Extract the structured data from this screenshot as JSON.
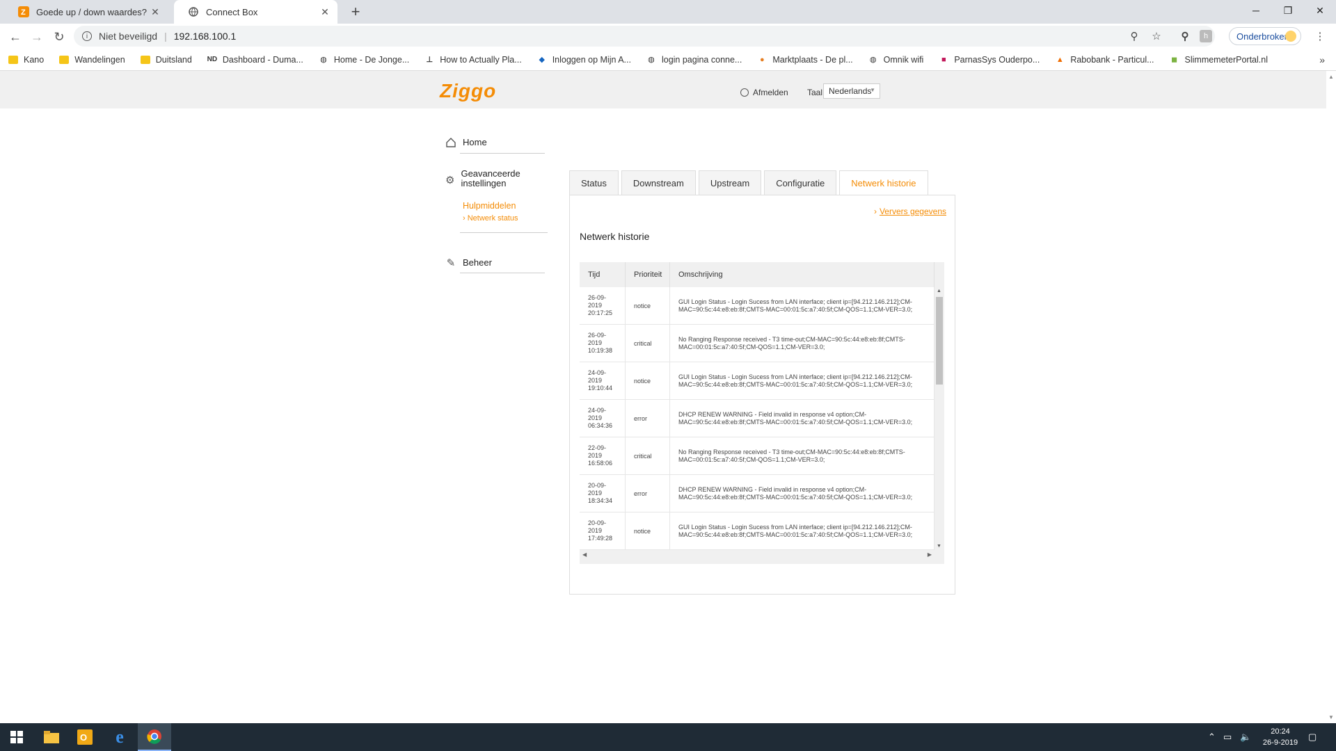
{
  "browser": {
    "tabs": [
      {
        "title": "Goede up / down waardes? | Zig",
        "active": false
      },
      {
        "title": "Connect Box",
        "active": true
      }
    ],
    "address": {
      "security": "Niet beveiligd",
      "url": "192.168.100.1"
    },
    "profile_label": "Onderbroken",
    "bookmarks": [
      {
        "label": "Kano",
        "icon": "folder-icon"
      },
      {
        "label": "Wandelingen",
        "icon": "folder-icon"
      },
      {
        "label": "Duitsland",
        "icon": "folder-icon"
      },
      {
        "label": "Dashboard - Duma...",
        "icon": "nd-icon"
      },
      {
        "label": "Home - De Jonge...",
        "icon": "globe-icon"
      },
      {
        "label": "How to Actually Pla...",
        "icon": "crane-icon"
      },
      {
        "label": "Inloggen op Mijn A...",
        "icon": "shield-icon"
      },
      {
        "label": "login pagina conne...",
        "icon": "globe-icon"
      },
      {
        "label": "Marktplaats - De pl...",
        "icon": "marktplaats-icon"
      },
      {
        "label": "Omnik wifi",
        "icon": "globe-icon"
      },
      {
        "label": "ParnasSys Ouderpo...",
        "icon": "parnassys-icon"
      },
      {
        "label": "Rabobank - Particul...",
        "icon": "rabobank-icon"
      },
      {
        "label": "SlimmemeterPortal.nl",
        "icon": "slimmemeter-icon"
      }
    ]
  },
  "header": {
    "logo": "Ziggo",
    "logout": "Afmelden",
    "lang_label": "Taal",
    "lang_value": "Nederlands"
  },
  "sidebar": {
    "home": "Home",
    "advanced": "Geavanceerde instellingen",
    "tools": "Hulpmiddelen",
    "network_status": "Netwerk status",
    "admin": "Beheer"
  },
  "tabs": [
    "Status",
    "Downstream",
    "Upstream",
    "Configuratie",
    "Netwerk historie"
  ],
  "panel": {
    "refresh": "Ververs gegevens",
    "title": "Netwerk historie",
    "columns": [
      "Tijd",
      "Prioriteit",
      "Omschrijving"
    ],
    "rows": [
      {
        "date": "26-09-",
        "year": "2019",
        "time": "20:17:25",
        "priority": "notice",
        "desc": "GUI Login Status - Login Sucess from LAN interface; client ip=[94.212.146.212];CM-MAC=90:5c:44:e8:eb:8f;CMTS-MAC=00:01:5c:a7:40:5f;CM-QOS=1.1;CM-VER=3.0;"
      },
      {
        "date": "26-09-",
        "year": "2019",
        "time": "10:19:38",
        "priority": "critical",
        "desc": "No Ranging Response received - T3 time-out;CM-MAC=90:5c:44:e8:eb:8f;CMTS-MAC=00:01:5c:a7:40:5f;CM-QOS=1.1;CM-VER=3.0;"
      },
      {
        "date": "24-09-",
        "year": "2019",
        "time": "19:10:44",
        "priority": "notice",
        "desc": "GUI Login Status - Login Sucess from LAN interface; client ip=[94.212.146.212];CM-MAC=90:5c:44:e8:eb:8f;CMTS-MAC=00:01:5c:a7:40:5f;CM-QOS=1.1;CM-VER=3.0;"
      },
      {
        "date": "24-09-",
        "year": "2019",
        "time": "06:34:36",
        "priority": "error",
        "desc": "DHCP RENEW WARNING - Field invalid in response v4 option;CM-MAC=90:5c:44:e8:eb:8f;CMTS-MAC=00:01:5c:a7:40:5f;CM-QOS=1.1;CM-VER=3.0;"
      },
      {
        "date": "22-09-",
        "year": "2019",
        "time": "16:58:06",
        "priority": "critical",
        "desc": "No Ranging Response received - T3 time-out;CM-MAC=90:5c:44:e8:eb:8f;CMTS-MAC=00:01:5c:a7:40:5f;CM-QOS=1.1;CM-VER=3.0;"
      },
      {
        "date": "20-09-",
        "year": "2019",
        "time": "18:34:34",
        "priority": "error",
        "desc": "DHCP RENEW WARNING - Field invalid in response v4 option;CM-MAC=90:5c:44:e8:eb:8f;CMTS-MAC=00:01:5c:a7:40:5f;CM-QOS=1.1;CM-VER=3.0;"
      },
      {
        "date": "20-09-",
        "year": "2019",
        "time": "17:49:28",
        "priority": "notice",
        "desc": "GUI Login Status - Login Sucess from LAN interface; client ip=[94.212.146.212];CM-MAC=90:5c:44:e8:eb:8f;CMTS-MAC=00:01:5c:a7:40:5f;CM-QOS=1.1;CM-VER=3.0;"
      }
    ]
  },
  "taskbar": {
    "time": "20:24",
    "date": "26-9-2019"
  },
  "colors": {
    "accent": "#f48c06",
    "taskbar": "#1f2b36"
  }
}
